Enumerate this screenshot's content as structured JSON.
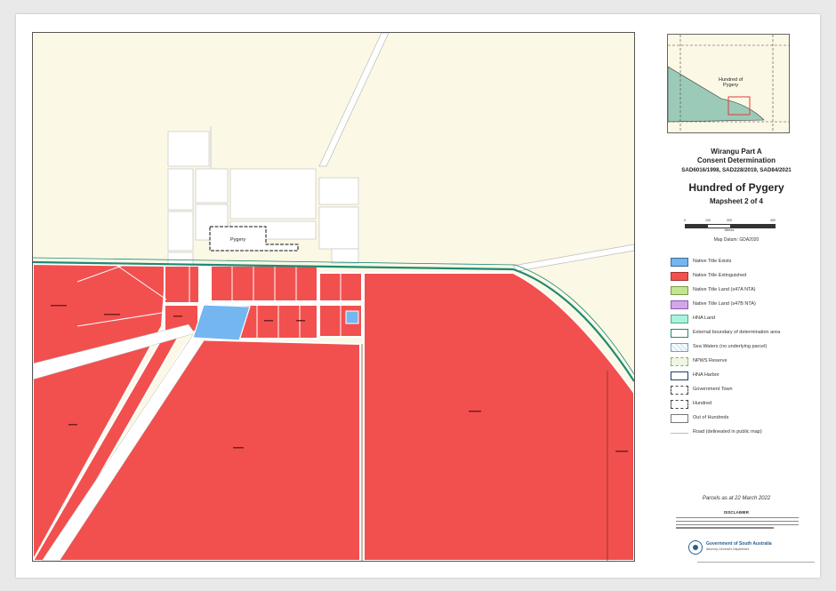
{
  "title": {
    "line1": "Wirangu Part A",
    "line2": "Consent Determination",
    "case_numbers": "SAD6016/1998, SAD228/2019, SAD84/2021",
    "hundred": "Hundred of Pygery",
    "mapsheet": "Mapsheet 2 of 4"
  },
  "inset": {
    "label": "Hundred of\nPygery"
  },
  "scale": {
    "ticks": [
      "0",
      "100",
      "200",
      "400"
    ],
    "unit": "Metres",
    "datum": "Map Datum: GDA2020"
  },
  "map_labels": {
    "town": "Pygery"
  },
  "legend": [
    {
      "label": "Native Title Exists",
      "fill": "#74b6f0",
      "border": "#3d6b96",
      "style": "solid"
    },
    {
      "label": "Native Title Extinguished",
      "fill": "#f1504f",
      "border": "#a33",
      "style": "solid"
    },
    {
      "label": "Native Title Land (s47A NTA)",
      "fill": "#c3e493",
      "border": "#7a9a4a",
      "style": "solid"
    },
    {
      "label": "Native Title Land (s47B NTA)",
      "fill": "#d2a6e8",
      "border": "#8a5ba6",
      "style": "solid"
    },
    {
      "label": "HNA Land",
      "fill": "#a9f2dd",
      "border": "#55a88d",
      "style": "solid"
    },
    {
      "label": "External boundary of determination area",
      "fill": "#ffffff",
      "border": "#1e8a75",
      "style": "solid"
    },
    {
      "label": "Sea Waters (no underlying parcel)",
      "fill": "#d7e9f5",
      "border": "#7aa2c0",
      "style": "hatch"
    },
    {
      "label": "NPWS Reserve",
      "fill": "#eef6e2",
      "border": "#7bb35a",
      "style": "dash"
    },
    {
      "label": "HNA Harbor",
      "fill": "#ffffff",
      "border": "#1d3f6e",
      "style": "solid"
    },
    {
      "label": "Government Town",
      "fill": "#ffffff",
      "border": "#444444",
      "style": "dash"
    },
    {
      "label": "Hundred",
      "fill": "#ffffff",
      "border": "#444444",
      "style": "longdash"
    },
    {
      "label": "Out of Hundreds",
      "fill": "#ffffff",
      "border": "#777777",
      "style": "solid"
    },
    {
      "label": "Road (delineated in public map)",
      "fill": "none",
      "border": "#bbbbbb",
      "style": "line"
    }
  ],
  "footer": {
    "parcels_date": "Parcels as at 22 March 2022",
    "disclaimer_title": "DISCLAIMER",
    "government": "Government of South Australia",
    "department": "Attorney-General's Department"
  },
  "colors": {
    "extinguished": "#f1504f",
    "exists": "#74b6f0",
    "background": "#fbf8e6",
    "boundary": "#1e8a75",
    "inset_fill": "#9ccab8",
    "inset_marker": "#e23b3b"
  }
}
